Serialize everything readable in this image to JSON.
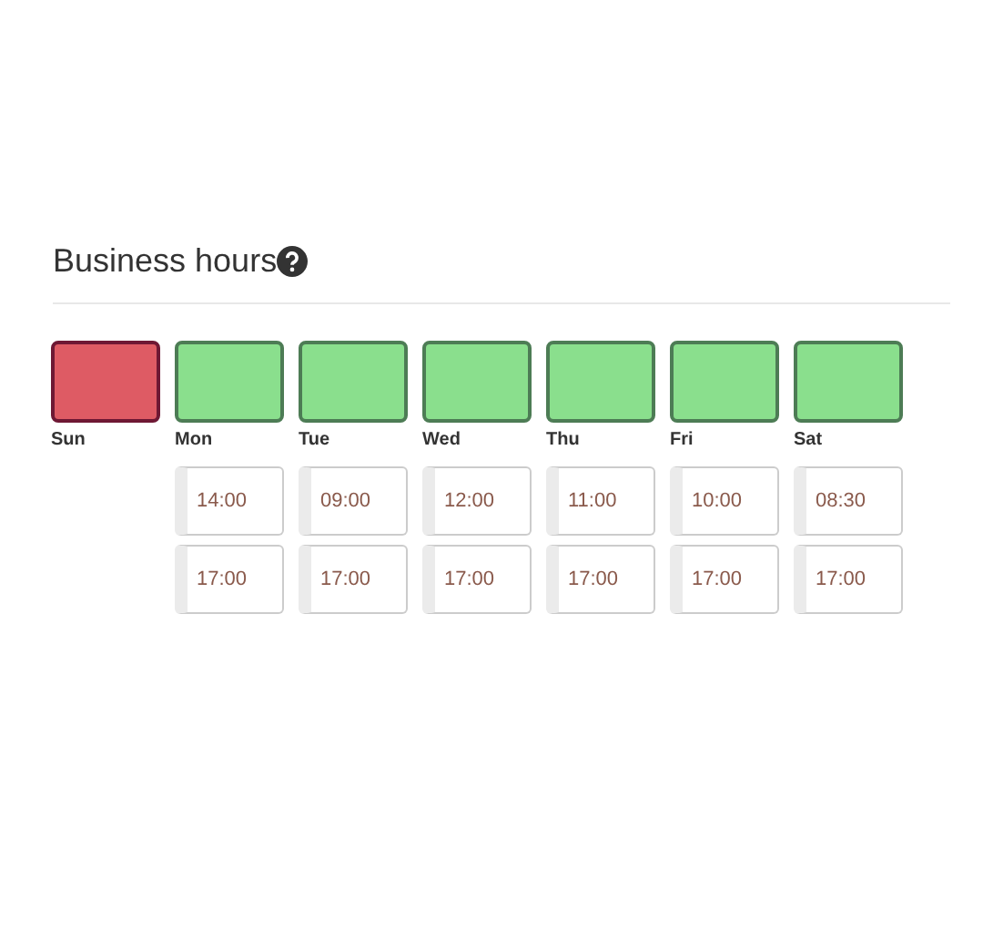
{
  "title": "Business hours",
  "days": [
    {
      "label": "Sun",
      "open": false
    },
    {
      "label": "Mon",
      "open": true,
      "start": "14:00",
      "end": "17:00"
    },
    {
      "label": "Tue",
      "open": true,
      "start": "09:00",
      "end": "17:00"
    },
    {
      "label": "Wed",
      "open": true,
      "start": "12:00",
      "end": "17:00"
    },
    {
      "label": "Thu",
      "open": true,
      "start": "11:00",
      "end": "17:00"
    },
    {
      "label": "Fri",
      "open": true,
      "start": "10:00",
      "end": "17:00"
    },
    {
      "label": "Sat",
      "open": true,
      "start": "08:30",
      "end": "17:00"
    }
  ]
}
